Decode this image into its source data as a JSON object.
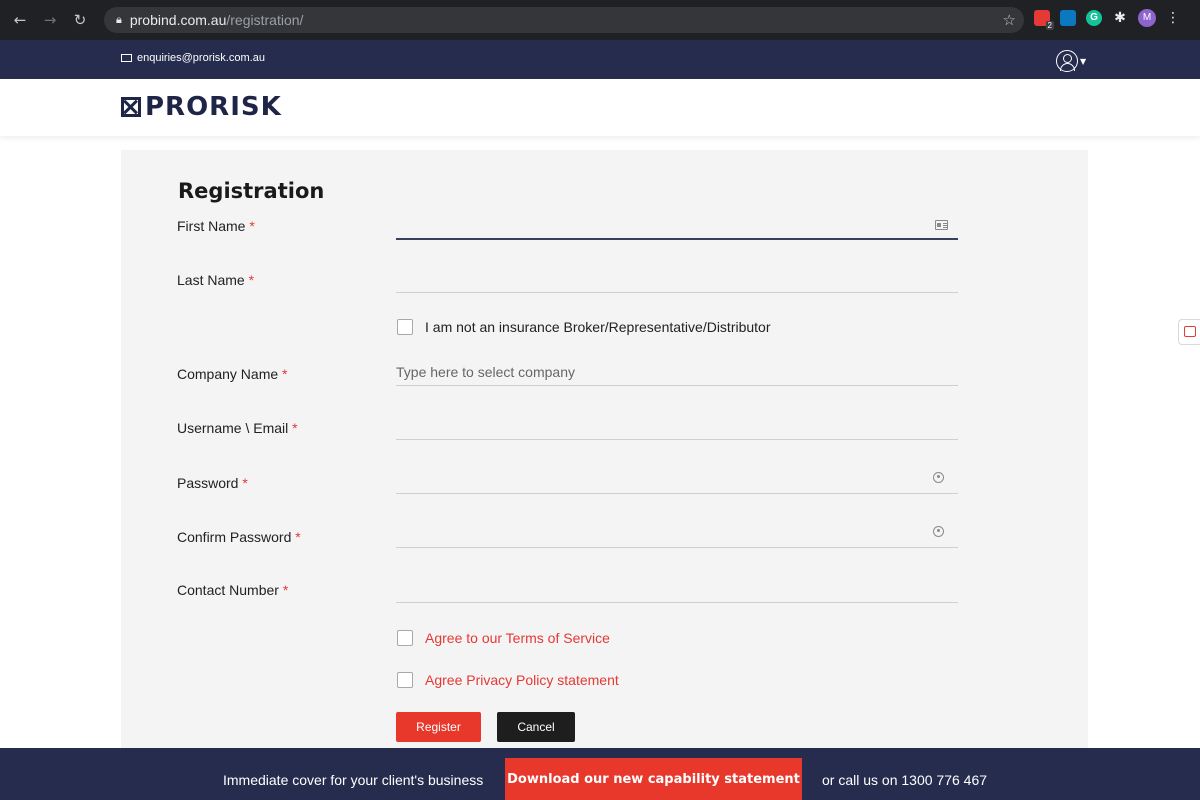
{
  "browser": {
    "url_host": "probind.com.au",
    "url_path": "/registration/",
    "extension_badge": "2",
    "profile_initial": "M"
  },
  "topbar": {
    "email": "enquiries@prorisk.com.au"
  },
  "header": {
    "logo_text": "PRORISK"
  },
  "form": {
    "title": "Registration",
    "required_marker": "*",
    "fields": {
      "first_name": "First Name",
      "last_name": "Last Name",
      "company_name": "Company Name",
      "company_placeholder": "Type here to select company",
      "username": "Username \\ Email",
      "password": "Password",
      "confirm_password": "Confirm Password",
      "contact_number": "Contact Number"
    },
    "checkboxes": {
      "not_broker": "I am not an insurance Broker/Representative/Distributor",
      "terms": "Agree to our Terms of Service",
      "privacy": "Agree Privacy Policy statement"
    },
    "buttons": {
      "register": "Register",
      "cancel": "Cancel"
    }
  },
  "footer": {
    "left_text": "Immediate cover for your client's business",
    "cta": "Download our new capability statement",
    "right_text": "or call us on 1300 776 467"
  },
  "colors": {
    "navy": "#252c4d",
    "accent_red": "#e8372b",
    "panel_bg": "#f4f4f4"
  }
}
